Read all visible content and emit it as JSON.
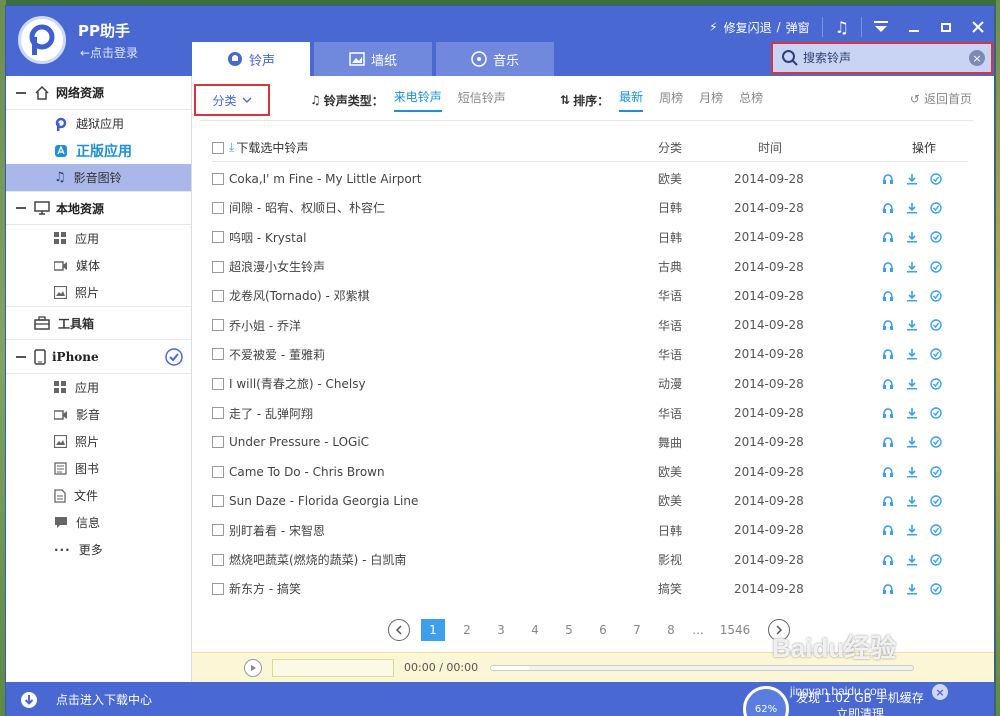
{
  "app": {
    "name": "PP助手",
    "login": "←点击登录"
  },
  "titlebar": {
    "repair_label": "修复闪退",
    "popup_label": "弹窗",
    "separator": "/"
  },
  "tabs": [
    {
      "label": "铃声",
      "active": true
    },
    {
      "label": "墙纸",
      "active": false
    },
    {
      "label": "音乐",
      "active": false
    }
  ],
  "search": {
    "placeholder": "搜索铃声"
  },
  "sidebar": {
    "net_group": "网络资源",
    "net_items": [
      {
        "label": "越狱应用",
        "icon": "p-logo-icon"
      },
      {
        "label": "正版应用",
        "icon": "app-store-icon"
      },
      {
        "label": "影音图铃",
        "icon": "music-note-icon"
      }
    ],
    "local_group": "本地资源",
    "local_items": [
      {
        "label": "应用",
        "icon": "grid-icon"
      },
      {
        "label": "媒体",
        "icon": "video-icon"
      },
      {
        "label": "照片",
        "icon": "photo-icon"
      }
    ],
    "tools": "工具箱",
    "device_group": "iPhone",
    "device_items": [
      {
        "label": "应用",
        "icon": "grid-icon"
      },
      {
        "label": "影音",
        "icon": "video-icon"
      },
      {
        "label": "照片",
        "icon": "photo-icon"
      },
      {
        "label": "图书",
        "icon": "book-icon"
      },
      {
        "label": "文件",
        "icon": "file-icon"
      },
      {
        "label": "信息",
        "icon": "message-icon"
      },
      {
        "label": "更多",
        "icon": "more-icon"
      }
    ],
    "download_center": "点击进入下载中心"
  },
  "filters": {
    "category_label": "分类",
    "ringtone_type_label": "铃声类型：",
    "ringtone_types": [
      "来电铃声",
      "短信铃声"
    ],
    "sort_label": "排序：",
    "sort_options": [
      "最新",
      "周榜",
      "月榜",
      "总榜"
    ],
    "back_home": "返回首页"
  },
  "table": {
    "header": {
      "download_selected": "下载选中铃声",
      "category": "分类",
      "time": "时间",
      "ops": "操作"
    },
    "rows": [
      {
        "name": "Coka,I'  m Fine - My Little Airport",
        "cat": "欧美",
        "time": "2014-09-28"
      },
      {
        "name": "间隙 - 昭宥、权顺日、朴容仁",
        "cat": "日韩",
        "time": "2014-09-28"
      },
      {
        "name": "呜咽 - Krystal",
        "cat": "日韩",
        "time": "2014-09-28"
      },
      {
        "name": "超浪漫小女生铃声",
        "cat": "古典",
        "time": "2014-09-28"
      },
      {
        "name": "龙卷风(Tornado) - 邓紫棋",
        "cat": "华语",
        "time": "2014-09-28"
      },
      {
        "name": "乔小姐 - 乔洋",
        "cat": "华语",
        "time": "2014-09-28"
      },
      {
        "name": "不爱被爱 - 董雅莉",
        "cat": "华语",
        "time": "2014-09-28"
      },
      {
        "name": "I will(青春之旅) - Chelsy",
        "cat": "动漫",
        "time": "2014-09-28"
      },
      {
        "name": "走了 - 乱弹阿翔",
        "cat": "华语",
        "time": "2014-09-28"
      },
      {
        "name": "Under Pressure - LOGiC",
        "cat": "舞曲",
        "time": "2014-09-28"
      },
      {
        "name": "Came To Do - Chris Brown",
        "cat": "欧美",
        "time": "2014-09-28"
      },
      {
        "name": "Sun Daze - Florida Georgia Line",
        "cat": "欧美",
        "time": "2014-09-28"
      },
      {
        "name": "别盯着看 - 宋智恩",
        "cat": "日韩",
        "time": "2014-09-28"
      },
      {
        "name": "燃烧吧蔬菜(燃烧的蔬菜) - 白凯南",
        "cat": "影视",
        "time": "2014-09-28"
      },
      {
        "name": "新东方 - 搞笑",
        "cat": "搞笑",
        "time": "2014-09-28"
      }
    ]
  },
  "pager": {
    "current": "1",
    "pages": [
      "2",
      "3",
      "4",
      "5",
      "6",
      "7",
      "8"
    ],
    "ellipsis": "...",
    "last": "1546"
  },
  "player": {
    "time": "00:00 / 00:00",
    "progress": 0.09
  },
  "cache": {
    "percent": "62%",
    "text": "发现 1.02 GB 手机缓存",
    "text2": "立即清理",
    "close": "×"
  },
  "watermark": {
    "brand": "Baidu经验",
    "url": "jingyan.baidu.com"
  },
  "colors": {
    "brand_blue": "#4a68d1",
    "accent_blue": "#1e8fd8",
    "highlight_red": "#d8343e"
  }
}
